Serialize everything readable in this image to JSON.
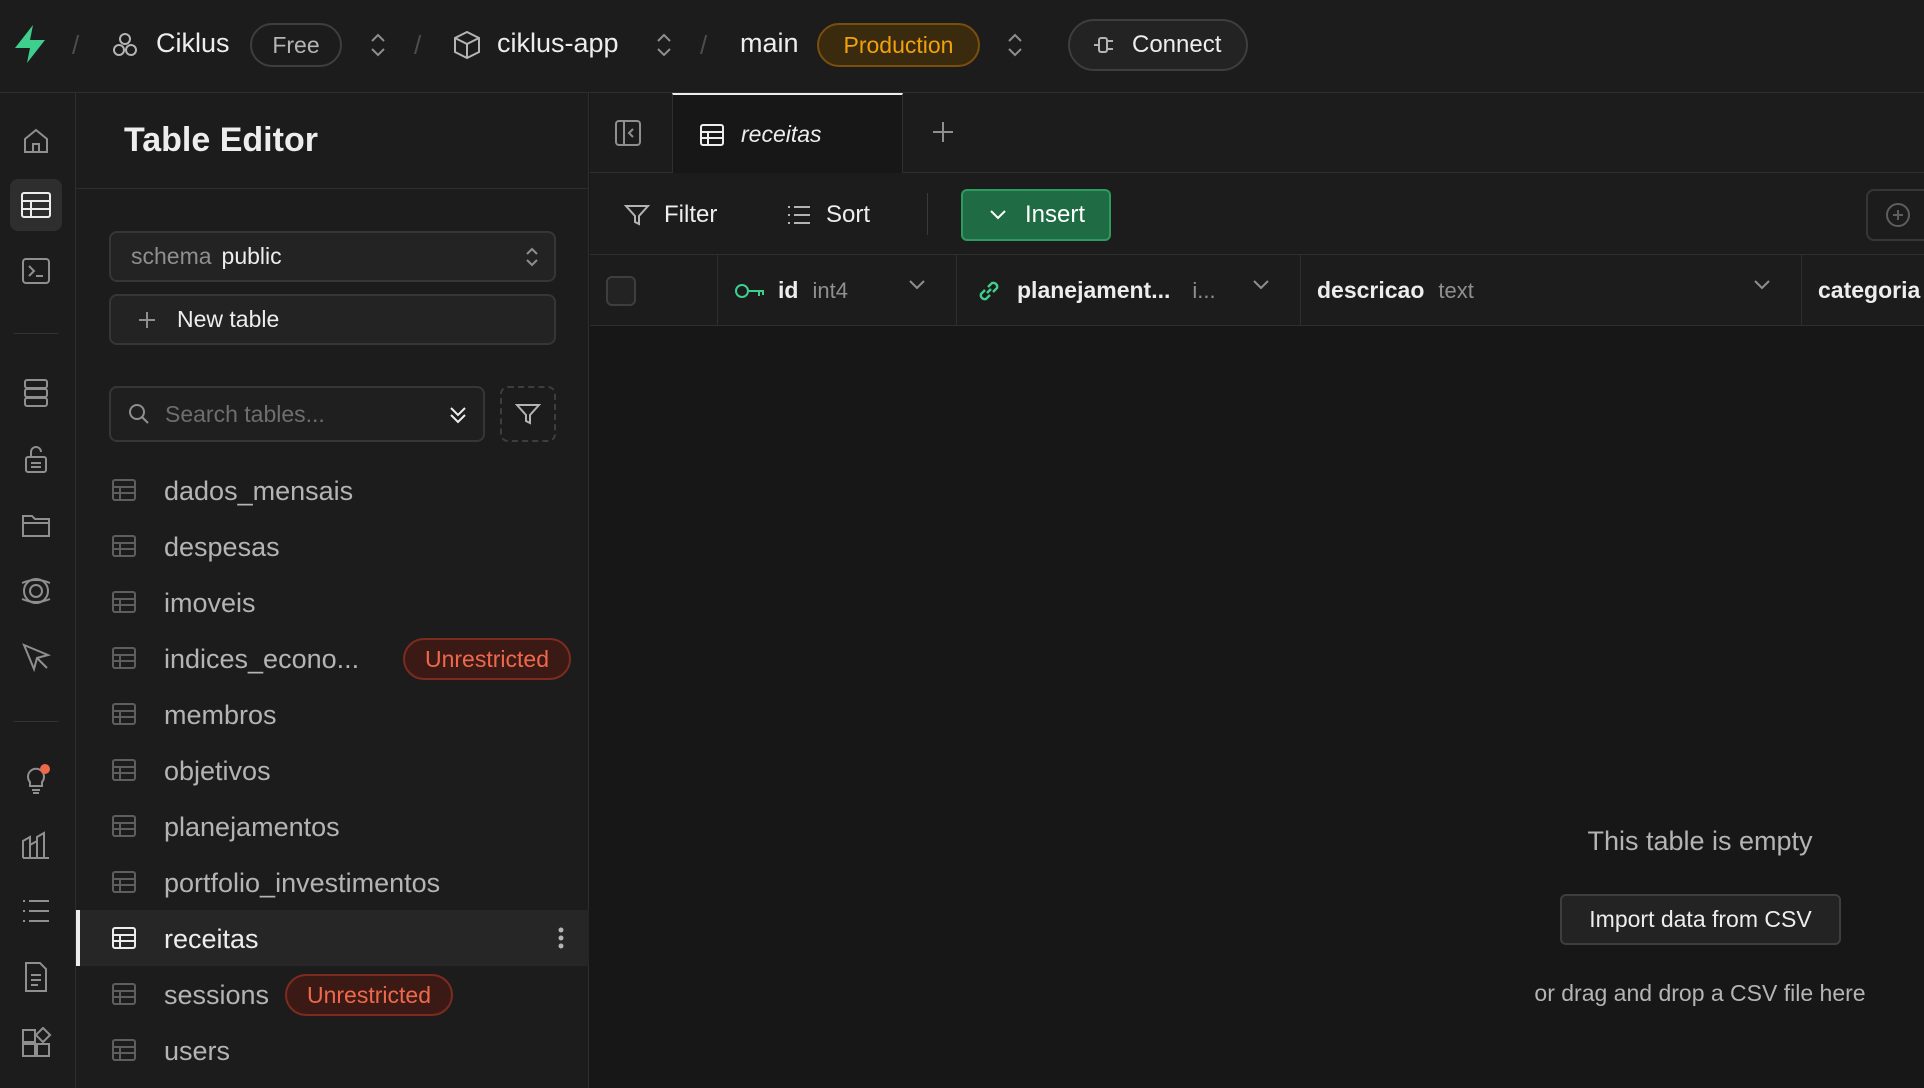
{
  "topbar": {
    "org_name": "Ciklus",
    "plan_badge": "Free",
    "project_name": "ciklus-app",
    "branch_name": "main",
    "env_badge": "Production",
    "connect_label": "Connect",
    "colors": {
      "brand": "#3ecf8e",
      "env": "#f1a10d"
    }
  },
  "rail": {
    "icons": [
      "home-icon",
      "table-editor-icon",
      "sql-editor-icon",
      "database-icon",
      "auth-icon",
      "storage-icon",
      "realtime-icon",
      "edge-functions-icon",
      "advisors-icon",
      "reports-icon",
      "logs-icon",
      "api-docs-icon",
      "integrations-icon"
    ],
    "active": "table-editor-icon"
  },
  "sidebar": {
    "title": "Table Editor",
    "schema_label": "schema",
    "schema_value": "public",
    "new_table_label": "New table",
    "search_placeholder": "Search tables...",
    "tables": [
      {
        "name": "dados_mensais"
      },
      {
        "name": "despesas"
      },
      {
        "name": "imoveis"
      },
      {
        "name": "indices_econo...",
        "badge": "Unrestricted"
      },
      {
        "name": "membros"
      },
      {
        "name": "objetivos"
      },
      {
        "name": "planejamentos"
      },
      {
        "name": "portfolio_investimentos"
      },
      {
        "name": "receitas",
        "active": true
      },
      {
        "name": "sessions",
        "badge": "Unrestricted"
      },
      {
        "name": "users"
      }
    ]
  },
  "main": {
    "tab_label": "receitas",
    "toolbar": {
      "filter_label": "Filter",
      "sort_label": "Sort",
      "insert_label": "Insert",
      "insert_color": "#1f6b43"
    },
    "columns": [
      {
        "name": "id",
        "type": "int4",
        "icon": "key-icon"
      },
      {
        "name": "planejament...",
        "type": "i...",
        "icon": "link-icon"
      },
      {
        "name": "descricao",
        "type": "text"
      },
      {
        "name": "categoria",
        "type": ""
      }
    ],
    "empty": {
      "title": "This table is empty",
      "import_label": "Import data from CSV",
      "hint": "or drag and drop a CSV file here"
    }
  }
}
